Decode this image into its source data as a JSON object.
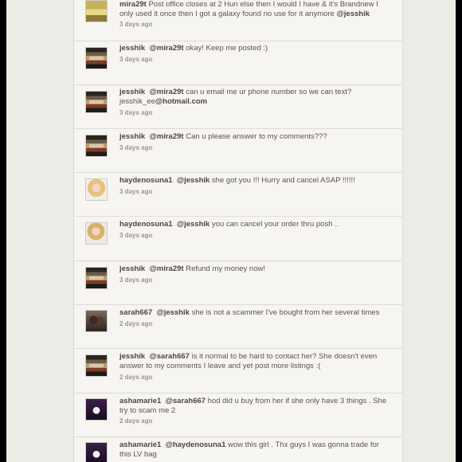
{
  "comments": [
    {
      "user": "mira29t",
      "mention": "",
      "line1": " Post office closes at 2 Hun else then I would I have & it's Brandnew I",
      "line2_pre": "only used it once then I got a galaxy found no use for it anymore ",
      "line2_mention": "@jesshik",
      "time": "3 days ago",
      "avatar": "yellow"
    },
    {
      "user": "jesshik",
      "mention": "@mira29t",
      "text": " okay! Keep me posted :)",
      "time": "3 days ago",
      "avatar": "room"
    },
    {
      "user": "jesshik",
      "mention": "@mira29t",
      "text": " can u email me ur phone number so we can text?",
      "line2_pre": "jesshik_ee",
      "line2_mention": "@hotmail.com",
      "time": "3 days ago",
      "avatar": "room"
    },
    {
      "user": "jesshik",
      "mention": "@mira29t",
      "text": "  Can u please answer to my comments???",
      "time": "3 days ago",
      "avatar": "room"
    },
    {
      "user": "haydenosuna1",
      "mention": "@jesshik",
      "text": "  she got you !!! Hurry and cancel ASAP !!!!!!",
      "time": "3 days ago",
      "avatar": "blonde"
    },
    {
      "user": "haydenosuna1",
      "mention": "@jesshik",
      "text": "  you can cancel your order thru posh ..",
      "time": "3 days ago",
      "avatar": "blonde-b"
    },
    {
      "user": "jesshik",
      "mention": "@mira29t",
      "text": "  Refund my money now!",
      "time": "3 days ago",
      "avatar": "room"
    },
    {
      "user": "sarah667",
      "mention": "@jesshik",
      "text": "  she is not a scammer I've bought from her several times",
      "time": "2 days ago",
      "avatar": "dark"
    },
    {
      "user": "jesshik",
      "mention": "@sarah667",
      "text": " is it normal to be hard to contact her? She doesn't even",
      "line2_pre": "answer to my comments I leave and yet post more listings :(",
      "line2_mention": "",
      "time": "2 days ago",
      "avatar": "room"
    },
    {
      "user": "ashamarie1",
      "mention": "@sarah667",
      "text": " hod did u buy from her if she only have 3 things . She",
      "line2_pre": "try to scam me 2",
      "line2_mention": "",
      "time": "2 days ago",
      "avatar": "purple"
    },
    {
      "user": "ashamarie1",
      "mention": "@haydenosuna1",
      "text": " wow this girl . Thx guys I was gonna trade for",
      "line2_pre": "this LV bag",
      "line2_mention": "",
      "time": "",
      "avatar": "purple"
    }
  ]
}
